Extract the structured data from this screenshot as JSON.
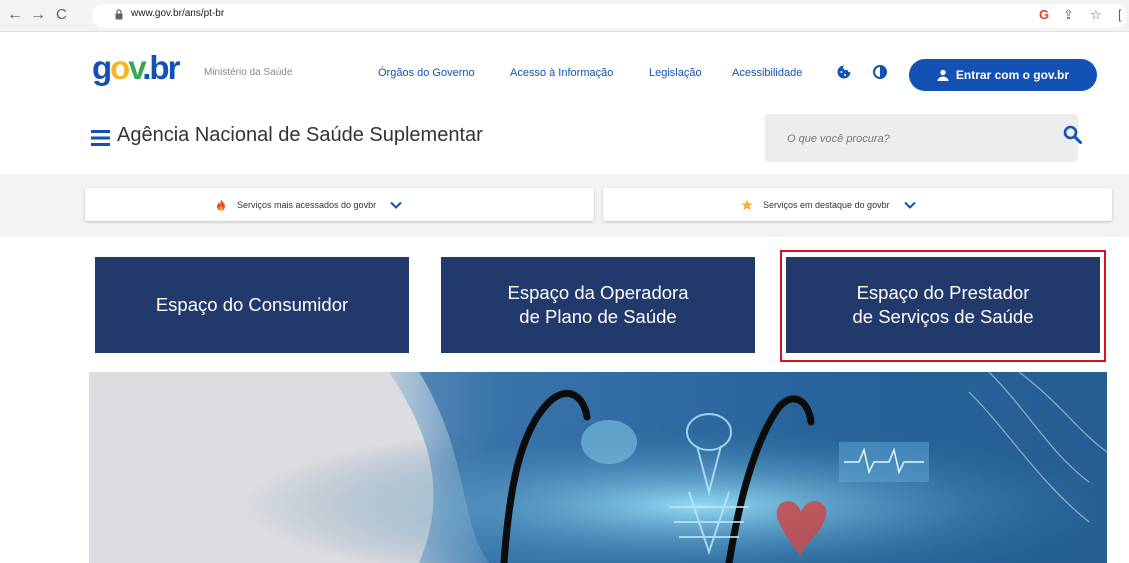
{
  "browser": {
    "back_icon": "←",
    "forward_icon": "→",
    "reload_icon": "C",
    "url": "www.gov.br/ans/pt-br",
    "g_icon": "G",
    "share_icon": "⇪",
    "star_icon": "☆",
    "more_icon": "["
  },
  "header": {
    "ministry": "Ministério da Saúde",
    "links": [
      "Órgãos do Governo",
      "Acesso à Informação",
      "Legislação",
      "Acessibilidade"
    ],
    "login_label": "Entrar com o gov.br",
    "agency_title": "Agência Nacional de Saúde Suplementar",
    "search_placeholder": "O que você procura?"
  },
  "services": {
    "most_accessed": "Serviços mais acessados do govbr",
    "featured": "Serviços em destaque do govbr"
  },
  "tiles": [
    "Espaço do Consumidor",
    "Espaço da Operadora\nde Plano de Saúde",
    "Espaço do Prestador\nde Serviços de Saúde"
  ],
  "colors": {
    "brand_blue": "#1351b4",
    "tile_navy": "#213a6b",
    "highlight_red": "#d9131b",
    "logo_yellow": "#f8b422",
    "logo_green": "#34a853"
  },
  "icons": [
    "lock-icon",
    "cookie-icon",
    "contrast-icon",
    "user-icon",
    "menu-icon",
    "search-icon",
    "fire-icon",
    "star-icon",
    "chevron-down-icon"
  ]
}
